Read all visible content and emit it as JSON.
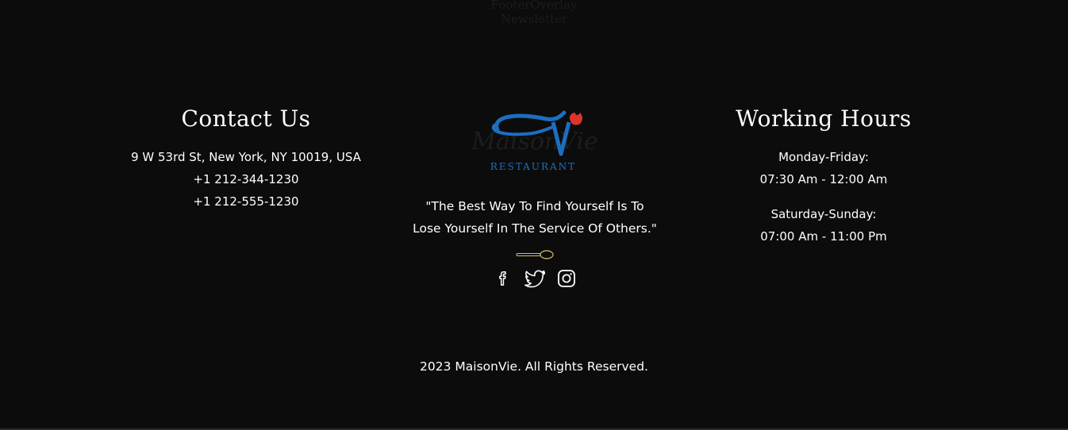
{
  "overlay": {
    "line1": "FooterOverlay",
    "line2": "Newsletter"
  },
  "contact": {
    "title": "Contact Us",
    "address": "9 W 53rd St, New York, NY 10019, USA",
    "phone1": "+1 212-344-1230",
    "phone2": "+1 212-555-1230"
  },
  "brand": {
    "logo_text": "MaisonVie",
    "logo_subtext": "RESTAURANT",
    "quote_line1": "\"The Best Way To Find Yourself Is To",
    "quote_line2": "Lose Yourself In The Service Of Others.\"",
    "socials": [
      "facebook-icon",
      "twitter-icon",
      "instagram-icon"
    ],
    "colors": {
      "logo_blue": "#1c6fc0",
      "logo_red": "#e0342a",
      "spoon_gold": "#d4c26a"
    }
  },
  "hours": {
    "title": "Working Hours",
    "weekday_label": "Monday-Friday:",
    "weekday_time": "07:30 Am - 12:00 Am",
    "weekend_label": "Saturday-Sunday:",
    "weekend_time": "07:00 Am - 11:00 Pm"
  },
  "footer": {
    "copyright": "2023 MaisonVie. All Rights Reserved."
  }
}
